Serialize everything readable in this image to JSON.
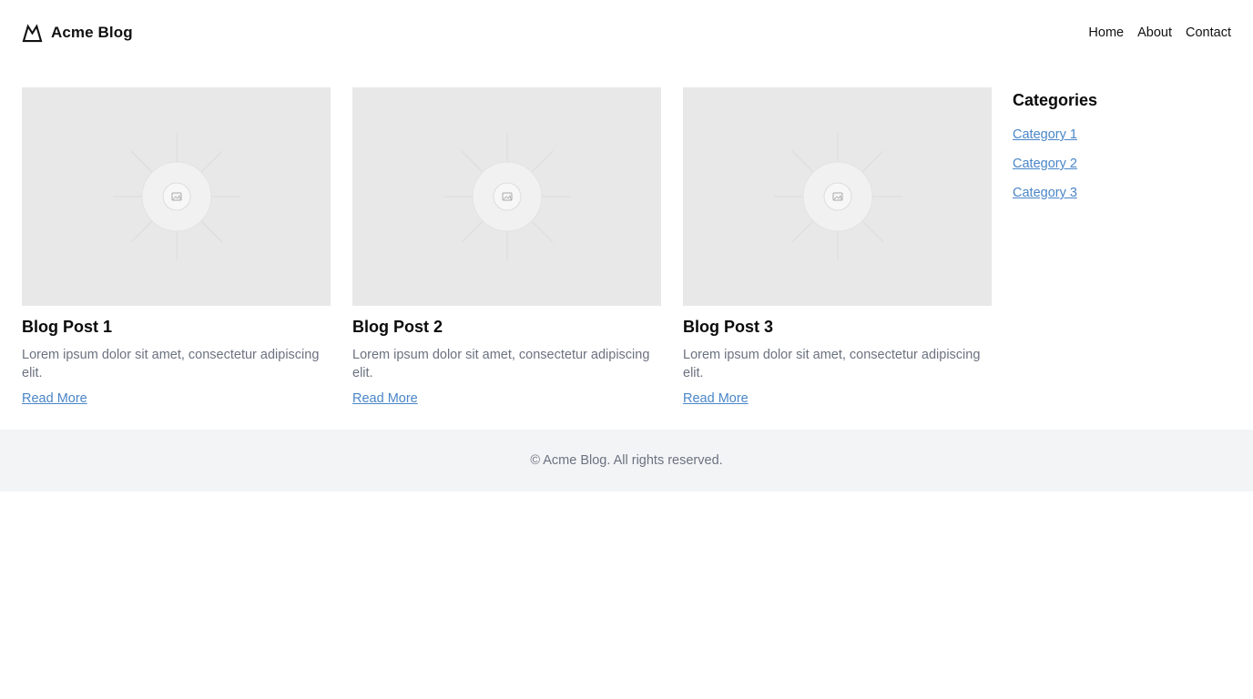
{
  "header": {
    "brand_name": "Acme Blog",
    "logo_icon": "mountain-logo-icon",
    "nav": [
      {
        "label": "Home"
      },
      {
        "label": "About"
      },
      {
        "label": "Contact"
      }
    ]
  },
  "posts": [
    {
      "image_icon": "image-placeholder-icon",
      "title": "Blog Post 1",
      "excerpt": "Lorem ipsum dolor sit amet, consectetur adipiscing elit.",
      "link_label": "Read More"
    },
    {
      "image_icon": "image-placeholder-icon",
      "title": "Blog Post 2",
      "excerpt": "Lorem ipsum dolor sit amet, consectetur adipiscing elit.",
      "link_label": "Read More"
    },
    {
      "image_icon": "image-placeholder-icon",
      "title": "Blog Post 3",
      "excerpt": "Lorem ipsum dolor sit amet, consectetur adipiscing elit.",
      "link_label": "Read More"
    }
  ],
  "sidebar": {
    "title": "Categories",
    "items": [
      {
        "label": "Category 1"
      },
      {
        "label": "Category 2"
      },
      {
        "label": "Category 3"
      }
    ]
  },
  "footer": {
    "text": "© Acme Blog. All rights reserved."
  },
  "colors": {
    "link": "#4a86c8",
    "muted_text": "#6b7280",
    "placeholder_bg": "#e8e8e8",
    "footer_bg": "#f3f4f6"
  }
}
